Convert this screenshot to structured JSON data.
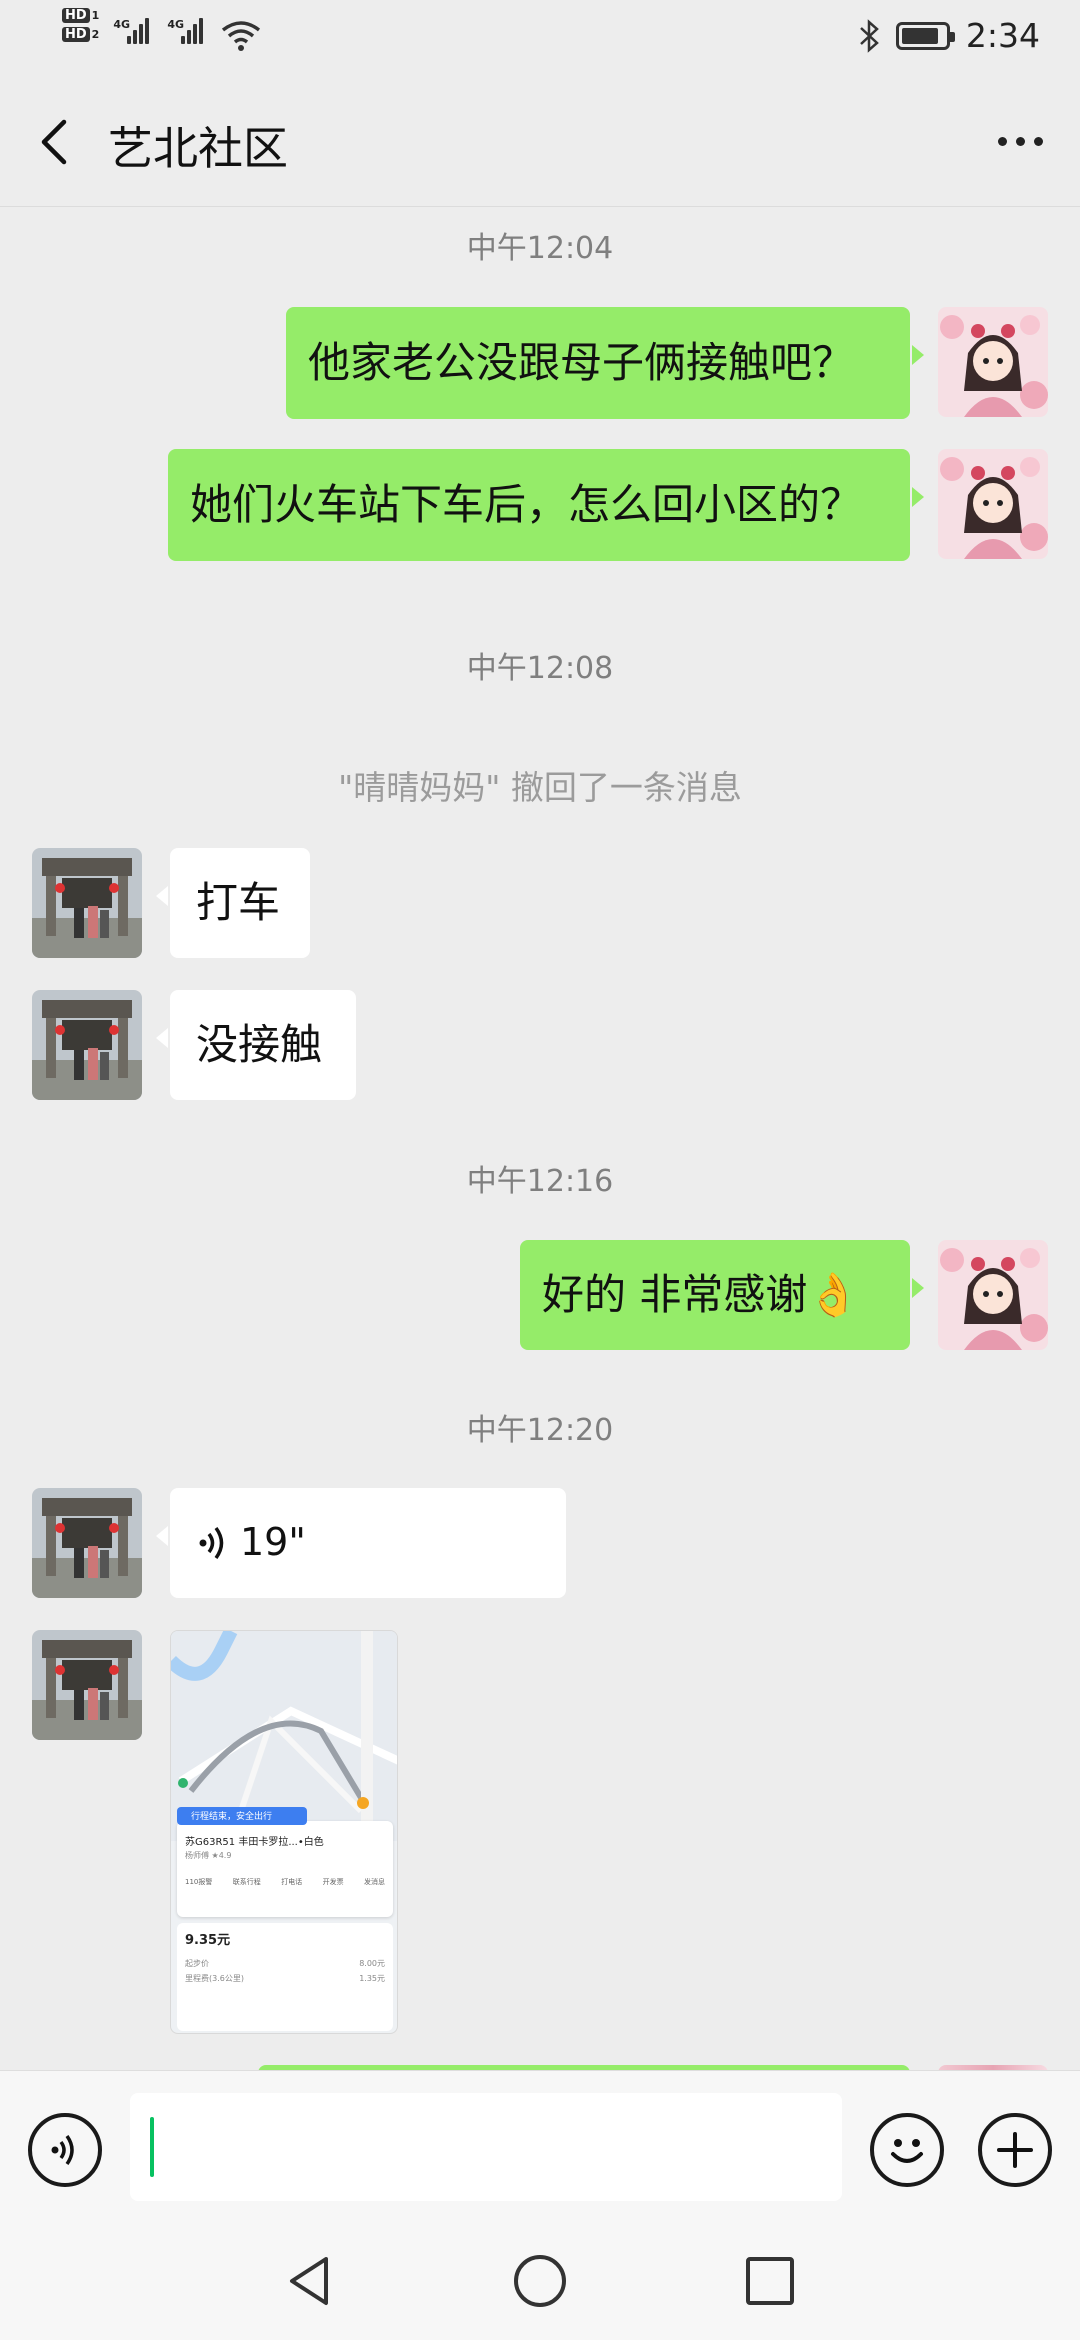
{
  "status_bar": {
    "hd1": "HD",
    "hd1_sub": "1",
    "hd2": "HD",
    "hd2_sub": "2",
    "net1": "4G",
    "net2": "4G",
    "time": "2:34",
    "battery_level": 0.85
  },
  "header": {
    "title": "艺北社区",
    "back_icon": "chevron-left-icon",
    "more_icon": "more-dots-icon"
  },
  "chat": {
    "time_1": "中午12:04",
    "msg_out_1": "他家老公没跟母子俩接触吧？",
    "msg_out_2": "她们火车站下车后，怎么回小区的？",
    "time_2": "中午12:08",
    "recall_notice": "\"晴晴妈妈\" 撤回了一条消息",
    "msg_in_1": "打车",
    "msg_in_2": "没接触",
    "time_3": "中午12:16",
    "msg_out_3": "好的 非常感谢👌",
    "time_4": "中午12:20",
    "voice_duration": "19\"",
    "image": {
      "banner": "行程结束，安全出行",
      "plate_line": "苏G63R51  丰田卡罗拉...•白色",
      "driver_line": "杨师傅 ★4.9",
      "actions": [
        "110报警",
        "联系行程",
        "打电话",
        "开发票",
        "发消息"
      ],
      "price": "9.35元",
      "rows": [
        {
          "label": "起步价",
          "value": "8.00元"
        },
        {
          "label": "里程费(3.6公里)",
          "value": "1.35元"
        }
      ]
    }
  },
  "input_bar": {
    "voice_icon": "voice-mode-icon",
    "emoji_icon": "emoji-icon",
    "plus_icon": "plus-icon"
  },
  "nav_bar": {
    "back": "triangle-back-icon",
    "home": "circle-home-icon",
    "recents": "square-recents-icon"
  },
  "colors": {
    "background": "#ededed",
    "outgoing_bubble": "#95ec69",
    "incoming_bubble": "#ffffff",
    "caret": "#07c160"
  }
}
